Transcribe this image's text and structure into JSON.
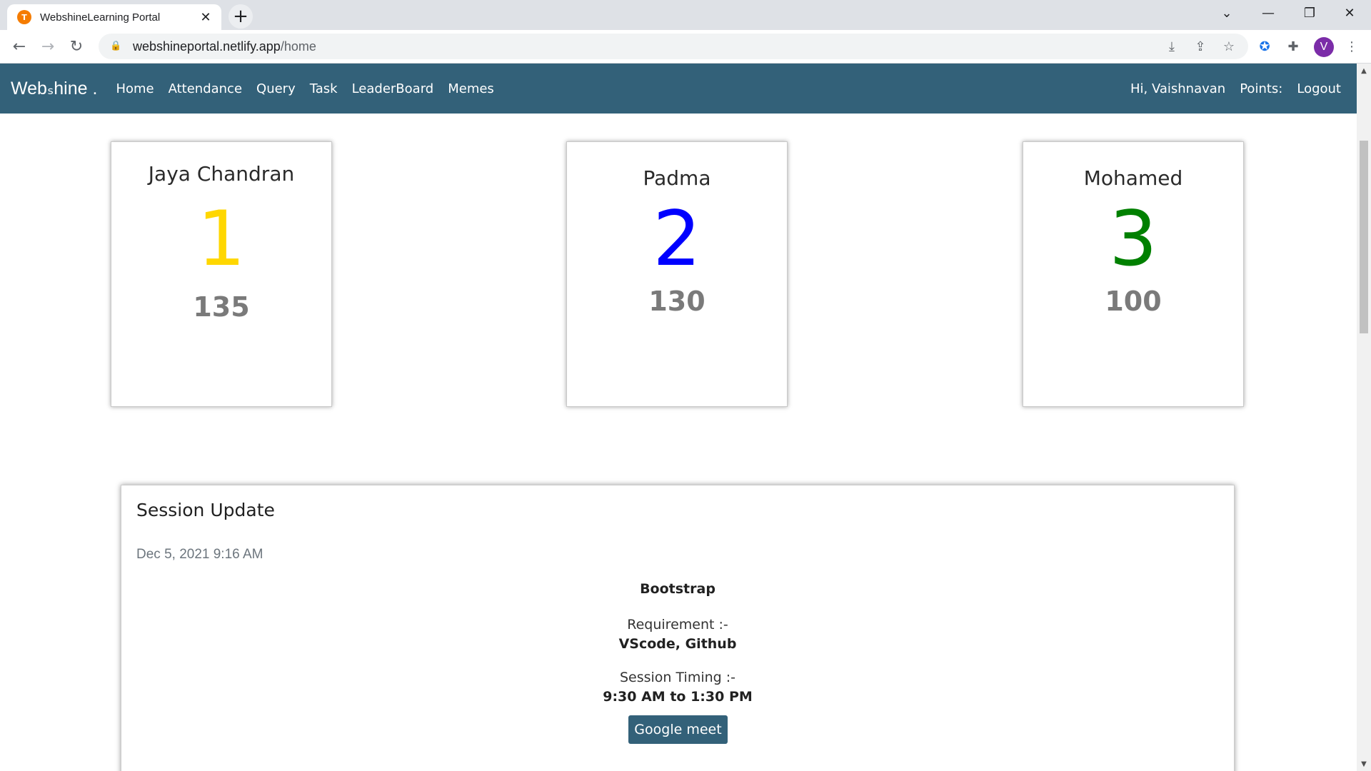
{
  "browser": {
    "tab_title": "WebshineLearning Portal",
    "url_host": "webshineportal.netlify.app",
    "url_path": "/home",
    "avatar_letter": "V",
    "favicon_letter": "T"
  },
  "nav": {
    "brand": "Webₛhine .",
    "links": [
      "Home",
      "Attendance",
      "Query",
      "Task",
      "LeaderBoard",
      "Memes"
    ],
    "greeting": "Hi, Vaishnavan",
    "points_label": "Points:",
    "logout": "Logout"
  },
  "leaderboard": [
    {
      "name": "Jaya Chandran",
      "rank": "1",
      "points": "135",
      "color": "#ffd700"
    },
    {
      "name": "Padma",
      "rank": "2",
      "points": "130",
      "color": "#0000ff"
    },
    {
      "name": "Mohamed",
      "rank": "3",
      "points": "100",
      "color": "#008000"
    }
  ],
  "session": {
    "title": "Session Update",
    "date": "Dec 5, 2021 9:16 AM",
    "topic": "Bootstrap",
    "requirement_label": "Requirement :-",
    "requirement_value": "VScode, Github",
    "timing_label": "Session Timing :-",
    "timing_value": "9:30 AM to 1:30 PM",
    "button": "Google meet"
  }
}
